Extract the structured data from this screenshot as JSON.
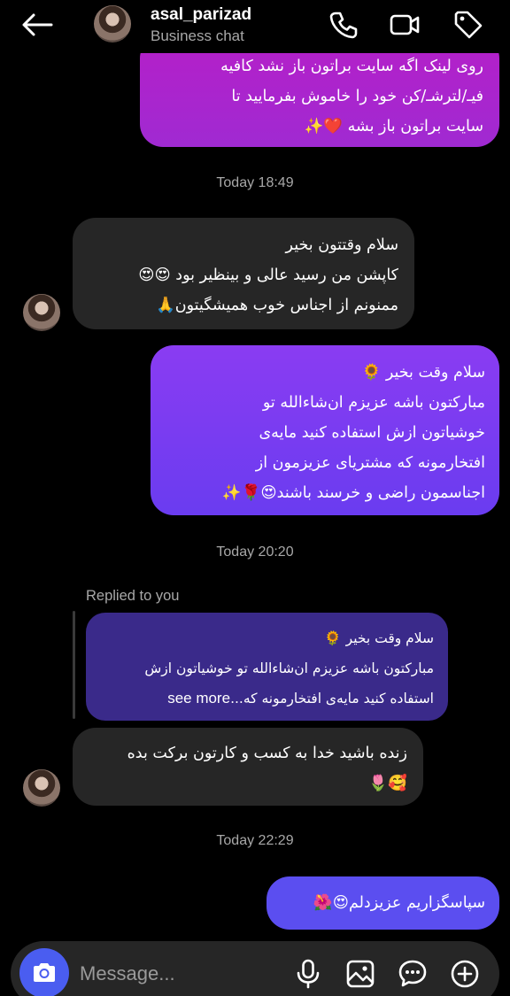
{
  "header": {
    "name": "asal_parizad",
    "subtitle": "Business chat",
    "icons": [
      "back-arrow-icon",
      "phone-icon",
      "video-icon",
      "tag-icon"
    ]
  },
  "messages": {
    "m1": {
      "lines": [
        "روی لینک اگه سایت براتون باز نشد کافیه",
        "فیـ/لترشـ/کن خود را خاموش بفرمایید تا",
        "سایت براتون باز بشه ❤️✨"
      ]
    },
    "t1": "Today 18:49",
    "m2": {
      "lines": [
        "سلام وقتتون بخیر",
        "کاپشن من رسید عالی و بینظیر بود 😍😍",
        "ممنونم از اجناس خوب همیشگیتون🙏"
      ]
    },
    "m3": {
      "lines": [
        "سلام وقت بخیر 🌻",
        "مبارکتون باشه عزیزم ان‌شاءالله تو",
        "خوشیاتون ازش استفاده کنید مایه‌ی",
        "افتخارمونه که مشتریای عزیزمون از",
        "اجناسمون راضی و خرسند باشند😍🌹✨"
      ]
    },
    "t2": "Today 20:20",
    "replied_label": "Replied to you",
    "quote": {
      "line1": "سلام وقت بخیر 🌻",
      "line2": "مبارکتون باشه عزیزم ان‌شاءالله تو خوشیاتون ازش",
      "line3": "استفاده کنید مایه‌ی افتخارمونه که...",
      "see_more": "see more"
    },
    "m4": {
      "lines": [
        "زنده باشید خدا به کسب و کارتون برکت بده",
        "🥰🌷"
      ]
    },
    "t3": "Today 22:29",
    "m5": {
      "lines": [
        "سپاسگزاریم عزیزدلم😍🌺"
      ]
    }
  },
  "composer": {
    "placeholder": "Message...",
    "icons": [
      "camera-icon",
      "microphone-icon",
      "gallery-icon",
      "sticker-icon",
      "plus-icon"
    ]
  },
  "colors": {
    "bubble_pink": "#b51fc8",
    "bubble_purple": "#7a3cf2",
    "bubble_blue": "#5b4ef0",
    "bubble_theirs": "#262626",
    "quote_bg": "#3a2a8a",
    "camera_button": "#4a5df0"
  }
}
